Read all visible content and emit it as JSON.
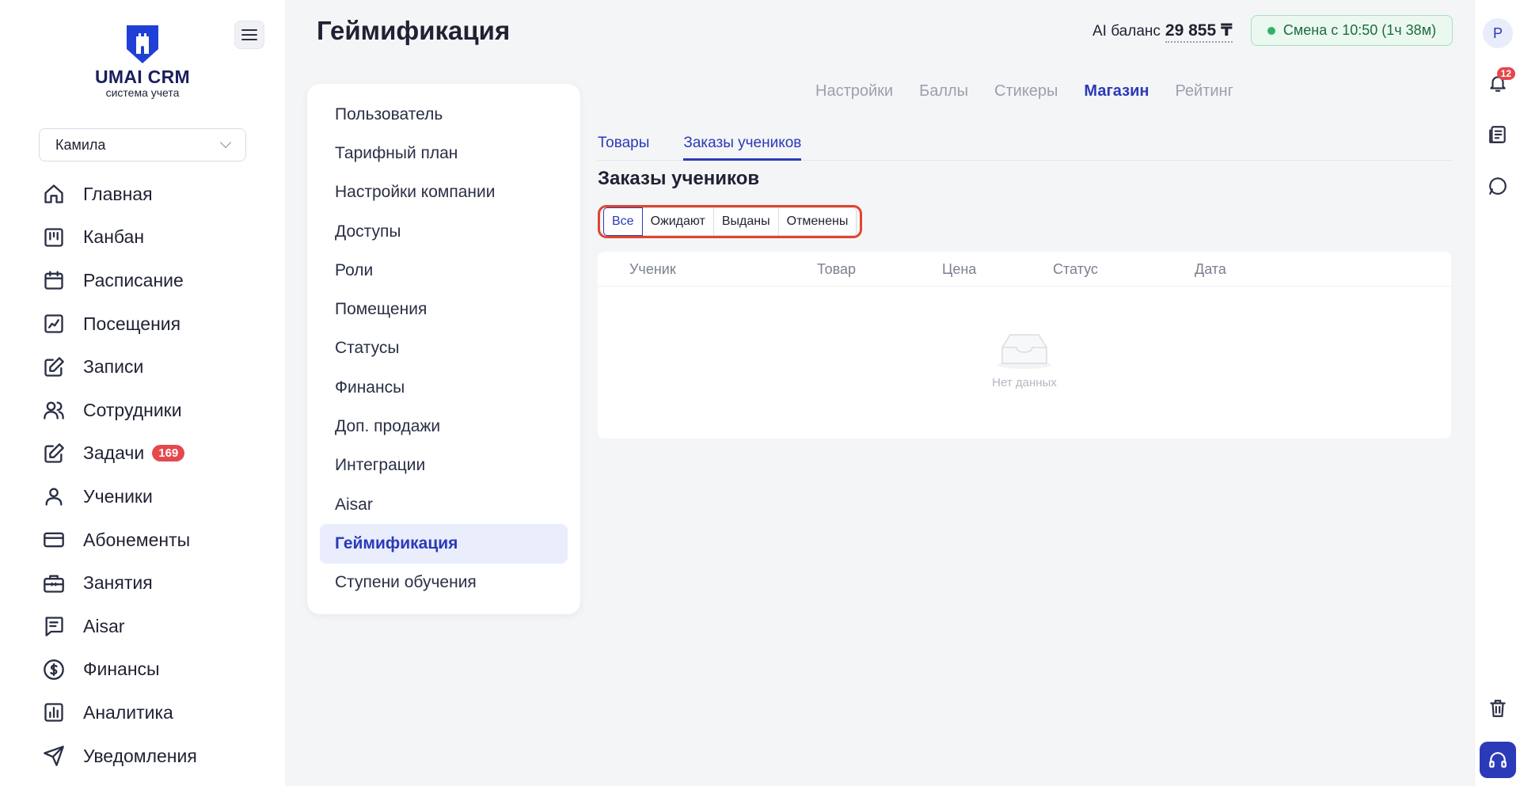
{
  "brand": {
    "name": "UMAI CRM",
    "subtitle": "система учета"
  },
  "sidebar": {
    "user_select": "Камила",
    "items": [
      {
        "label": "Главная",
        "icon": "home-icon"
      },
      {
        "label": "Канбан",
        "icon": "kanban-icon"
      },
      {
        "label": "Расписание",
        "icon": "calendar-icon"
      },
      {
        "label": "Посещения",
        "icon": "attendance-icon"
      },
      {
        "label": "Записи",
        "icon": "edit-icon"
      },
      {
        "label": "Сотрудники",
        "icon": "users-icon"
      },
      {
        "label": "Задачи",
        "icon": "tasks-icon",
        "badge": "169"
      },
      {
        "label": "Ученики",
        "icon": "user-icon"
      },
      {
        "label": "Абонементы",
        "icon": "card-icon"
      },
      {
        "label": "Занятия",
        "icon": "briefcase-icon"
      },
      {
        "label": "Aisar",
        "icon": "chat-icon"
      },
      {
        "label": "Финансы",
        "icon": "dollar-icon"
      },
      {
        "label": "Аналитика",
        "icon": "chart-icon"
      },
      {
        "label": "Уведомления",
        "icon": "send-icon"
      }
    ]
  },
  "header": {
    "title": "Геймификация",
    "ai_balance_label": "AI баланс",
    "ai_balance_value": "29 855 ₸",
    "shift": "Смена с 10:50 (1ч 38м)"
  },
  "rail": {
    "avatar": "Р",
    "notifications": "12"
  },
  "settings_menu": {
    "items": [
      "Пользователь",
      "Тарифный план",
      "Настройки компании",
      "Доступы",
      "Роли",
      "Помещения",
      "Статусы",
      "Финансы",
      "Доп. продажи",
      "Интеграции",
      "Aisar",
      "Геймификация",
      "Ступени обучения"
    ],
    "active_index": 11
  },
  "top_tabs": {
    "items": [
      "Настройки",
      "Баллы",
      "Стикеры",
      "Магазин",
      "Рейтинг"
    ],
    "active": "Магазин"
  },
  "sub_tabs": {
    "items": [
      "Товары",
      "Заказы учеников"
    ],
    "active": "Заказы учеников"
  },
  "section_title": "Заказы учеников",
  "filters": {
    "items": [
      "Все",
      "Ожидают",
      "Выданы",
      "Отменены"
    ],
    "active": "Все"
  },
  "table": {
    "columns": [
      "Ученик",
      "Товар",
      "Цена",
      "Статус",
      "Дата"
    ],
    "empty_text": "Нет данных"
  },
  "colors": {
    "accent": "#2b3ab8",
    "badge": "#e5484d",
    "highlight": "#e2452d",
    "shift_bg": "#eaf8f0"
  }
}
